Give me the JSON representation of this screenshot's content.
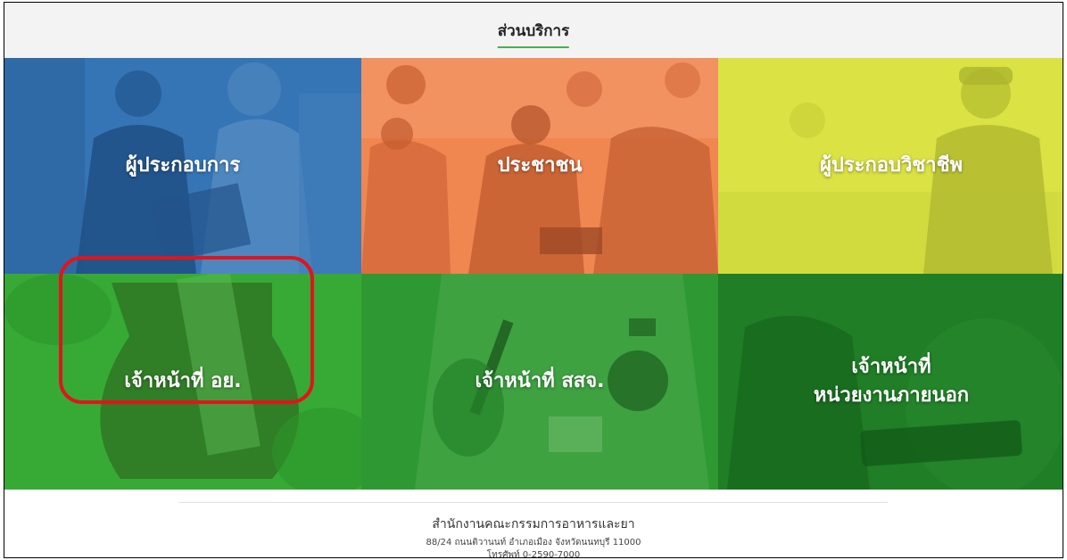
{
  "header": {
    "title": "ส่วนบริการ"
  },
  "tiles": [
    {
      "label": "ผู้ประกอบการ",
      "color": "#2f6fb0"
    },
    {
      "label": "ประชาชน",
      "color": "#f07f45"
    },
    {
      "label": "ผู้ประกอบวิชาชีพ",
      "color": "#d7e03a"
    },
    {
      "label": "เจ้าหน้าที่ อย.",
      "color": "#33a833"
    },
    {
      "label": "เจ้าหน้าที่ สสจ.",
      "color": "#2a962f"
    },
    {
      "label": "เจ้าหน้าที่\nหน่วยงานภายนอก",
      "color": "#1d7a24"
    }
  ],
  "highlight_color": "#e0151b",
  "footer": {
    "org": "สำนักงานคณะกรรมการอาหารและยา",
    "address": "88/24 ถนนติวานนท์ อำเภอเมือง จังหวัดนนทบุรี 11000",
    "phone": "โทรศัพท์ 0-2590-7000"
  }
}
